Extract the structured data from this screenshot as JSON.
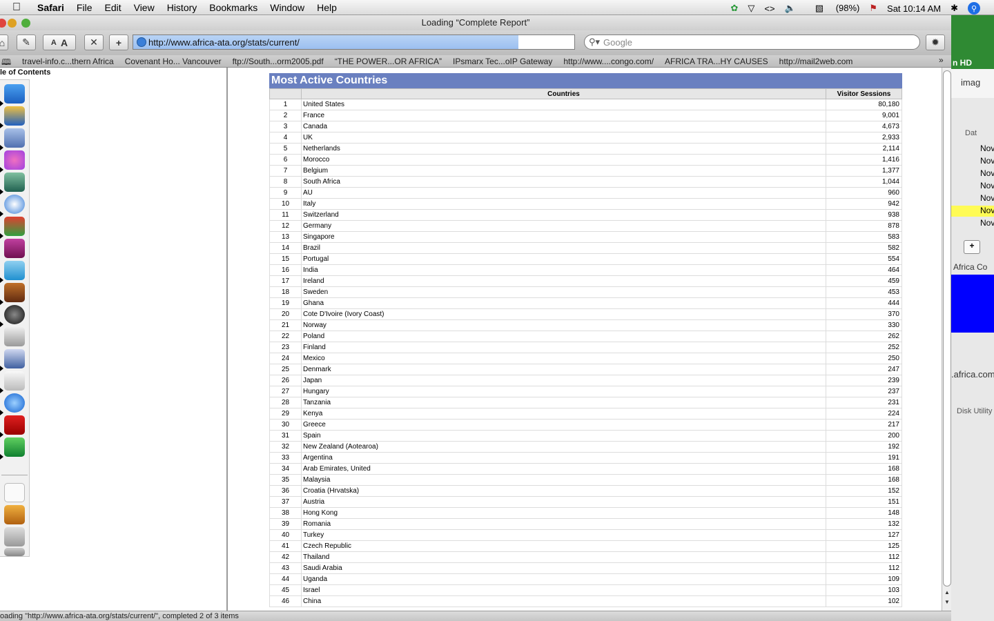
{
  "menubar": {
    "app": "Safari",
    "menus": [
      "File",
      "Edit",
      "View",
      "History",
      "Bookmarks",
      "Window",
      "Help"
    ],
    "battery": "(98%)",
    "clock": "Sat 10:14 AM"
  },
  "window": {
    "title": "Loading “Complete Report”",
    "url": "http://www.africa-ata.org/stats/current/",
    "search_placeholder": "Google",
    "bookmarks": [
      "travel-info.c...thern Africa",
      "Covenant Ho... Vancouver",
      "ftp://South...orm2005.pdf",
      "“THE POWER...OR AFRICA”",
      "IPsmarx Tec...oIP Gateway",
      "http://www....congo.com/",
      "AFRICA TRA...HY CAUSES",
      "http://mail2web.com"
    ],
    "status": "oading \"http://www.africa-ata.org/stats/current/\", completed 2 of 3 items"
  },
  "sidebar": {
    "toc_label": "le of Contents"
  },
  "report": {
    "title": "Most Active Countries",
    "columns": [
      "Countries",
      "Visitor Sessions"
    ],
    "rows": [
      {
        "rank": "1",
        "country": "United States",
        "sessions": "80,180"
      },
      {
        "rank": "2",
        "country": "France",
        "sessions": "9,001"
      },
      {
        "rank": "3",
        "country": "Canada",
        "sessions": "4,673"
      },
      {
        "rank": "4",
        "country": "UK",
        "sessions": "2,933"
      },
      {
        "rank": "5",
        "country": "Netherlands",
        "sessions": "2,114"
      },
      {
        "rank": "6",
        "country": "Morocco",
        "sessions": "1,416"
      },
      {
        "rank": "7",
        "country": "Belgium",
        "sessions": "1,377"
      },
      {
        "rank": "8",
        "country": "South Africa",
        "sessions": "1,044"
      },
      {
        "rank": "9",
        "country": "AU",
        "sessions": "960"
      },
      {
        "rank": "10",
        "country": "Italy",
        "sessions": "942"
      },
      {
        "rank": "11",
        "country": "Switzerland",
        "sessions": "938"
      },
      {
        "rank": "12",
        "country": "Germany",
        "sessions": "878"
      },
      {
        "rank": "13",
        "country": "Singapore",
        "sessions": "583"
      },
      {
        "rank": "14",
        "country": "Brazil",
        "sessions": "582"
      },
      {
        "rank": "15",
        "country": "Portugal",
        "sessions": "554"
      },
      {
        "rank": "16",
        "country": "India",
        "sessions": "464"
      },
      {
        "rank": "17",
        "country": "Ireland",
        "sessions": "459"
      },
      {
        "rank": "18",
        "country": "Sweden",
        "sessions": "453"
      },
      {
        "rank": "19",
        "country": "Ghana",
        "sessions": "444"
      },
      {
        "rank": "20",
        "country": "Cote D'Ivoire (Ivory Coast)",
        "sessions": "370"
      },
      {
        "rank": "21",
        "country": "Norway",
        "sessions": "330"
      },
      {
        "rank": "22",
        "country": "Poland",
        "sessions": "262"
      },
      {
        "rank": "23",
        "country": "Finland",
        "sessions": "252"
      },
      {
        "rank": "24",
        "country": "Mexico",
        "sessions": "250"
      },
      {
        "rank": "25",
        "country": "Denmark",
        "sessions": "247"
      },
      {
        "rank": "26",
        "country": "Japan",
        "sessions": "239"
      },
      {
        "rank": "27",
        "country": "Hungary",
        "sessions": "237"
      },
      {
        "rank": "28",
        "country": "Tanzania",
        "sessions": "231"
      },
      {
        "rank": "29",
        "country": "Kenya",
        "sessions": "224"
      },
      {
        "rank": "30",
        "country": "Greece",
        "sessions": "217"
      },
      {
        "rank": "31",
        "country": "Spain",
        "sessions": "200"
      },
      {
        "rank": "32",
        "country": "New Zealand (Aotearoa)",
        "sessions": "192"
      },
      {
        "rank": "33",
        "country": "Argentina",
        "sessions": "191"
      },
      {
        "rank": "34",
        "country": "Arab Emirates, United",
        "sessions": "168"
      },
      {
        "rank": "35",
        "country": "Malaysia",
        "sessions": "168"
      },
      {
        "rank": "36",
        "country": "Croatia (Hrvatska)",
        "sessions": "152"
      },
      {
        "rank": "37",
        "country": "Austria",
        "sessions": "151"
      },
      {
        "rank": "38",
        "country": "Hong Kong",
        "sessions": "148"
      },
      {
        "rank": "39",
        "country": "Romania",
        "sessions": "132"
      },
      {
        "rank": "40",
        "country": "Turkey",
        "sessions": "127"
      },
      {
        "rank": "41",
        "country": "Czech Republic",
        "sessions": "125"
      },
      {
        "rank": "42",
        "country": "Thailand",
        "sessions": "112"
      },
      {
        "rank": "43",
        "country": "Saudi Arabia",
        "sessions": "112"
      },
      {
        "rank": "44",
        "country": "Uganda",
        "sessions": "109"
      },
      {
        "rank": "45",
        "country": "Israel",
        "sessions": "103"
      },
      {
        "rank": "46",
        "country": "China",
        "sessions": "102"
      }
    ]
  },
  "background_window": {
    "hd_label": "n HD",
    "img_label": "imag",
    "dat_label": "Dat",
    "now_items": [
      "Nov",
      "Nov",
      "Nov",
      "Nov",
      "Nov",
      "Nov",
      "Nov"
    ],
    "africa_label": "Africa  Co",
    "africacom_label": ".africa.com",
    "disk_label": "Disk Utility"
  },
  "colors": {
    "report_header": "#6a80c0",
    "url_progress": "#9cc0f0",
    "bg_green": "#2f8a33",
    "bg_blue": "#0000ff",
    "bg_yellow": "#fffb55"
  },
  "icons": [
    "apple-icon",
    "finder-icon",
    "safari-compass-icon",
    "ie-icon",
    "acrobat-icon",
    "trash-icon",
    "globe-icon",
    "search-magnifier-icon"
  ]
}
